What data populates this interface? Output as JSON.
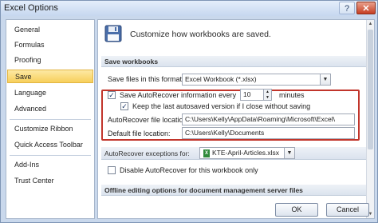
{
  "window": {
    "title": "Excel Options",
    "help_glyph": "?",
    "close_glyph": "✕"
  },
  "sidebar": {
    "items": [
      {
        "label": "General"
      },
      {
        "label": "Formulas"
      },
      {
        "label": "Proofing"
      },
      {
        "label": "Save",
        "selected": true
      },
      {
        "label": "Language"
      },
      {
        "label": "Advanced"
      },
      {
        "label": "Customize Ribbon"
      },
      {
        "label": "Quick Access Toolbar"
      },
      {
        "label": "Add-Ins"
      },
      {
        "label": "Trust Center"
      }
    ]
  },
  "header": {
    "text": "Customize how workbooks are saved."
  },
  "save_workbooks": {
    "section_title": "Save workbooks",
    "format_label": "Save files in this format:",
    "format_value": "Excel Workbook (*.xlsx)",
    "autorecover_label": "Save AutoRecover information every",
    "autorecover_checked": true,
    "autorecover_minutes": "10",
    "minutes_label": "minutes",
    "keep_last_label": "Keep the last autosaved version if I close without saving",
    "keep_last_checked": true,
    "autorecover_location_label": "AutoRecover file location:",
    "autorecover_location_value": "C:\\Users\\Kelly\\AppData\\Roaming\\Microsoft\\Excel\\",
    "default_location_label": "Default file location:",
    "default_location_value": "C:\\Users\\Kelly\\Documents"
  },
  "exceptions": {
    "label": "AutoRecover exceptions for:",
    "workbook": "KTE-April-Articles.xlsx",
    "disable_label": "Disable AutoRecover for this workbook only",
    "disable_checked": false
  },
  "offline": {
    "section_title": "Offline editing options for document management server files"
  },
  "footer": {
    "ok_label": "OK",
    "cancel_label": "Cancel"
  },
  "colors": {
    "highlight_border": "#c1352b",
    "selected_nav": "#f7cf5b"
  }
}
